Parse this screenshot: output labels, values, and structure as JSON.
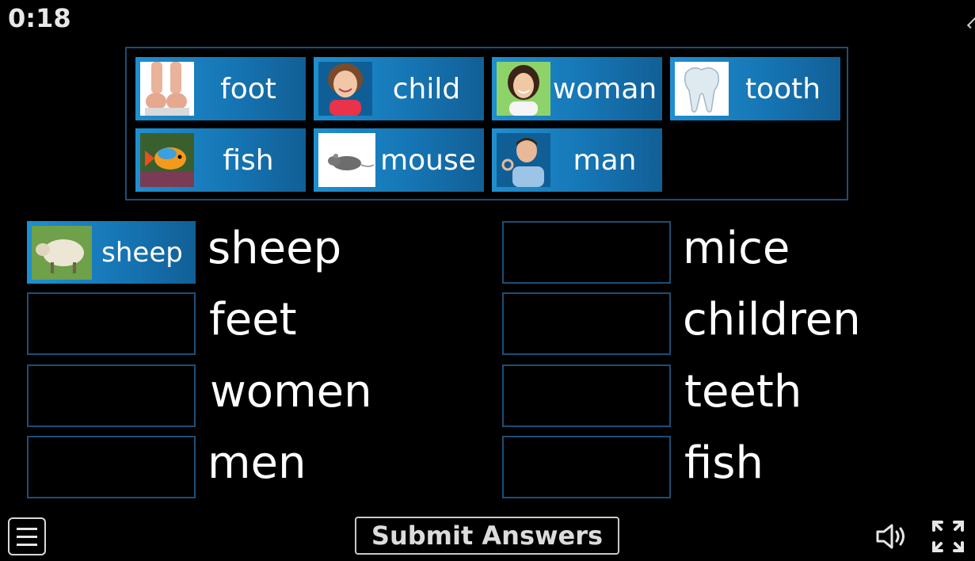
{
  "timer": "0:18",
  "bank": {
    "tiles": [
      {
        "label": "foot",
        "icon": "foot-photo"
      },
      {
        "label": "child",
        "icon": "child-photo"
      },
      {
        "label": "woman",
        "icon": "woman-photo"
      },
      {
        "label": "tooth",
        "icon": "tooth-photo"
      },
      {
        "label": "fish",
        "icon": "fish-photo"
      },
      {
        "label": "mouse",
        "icon": "mouse-photo"
      },
      {
        "label": "man",
        "icon": "man-photo"
      }
    ]
  },
  "targets": {
    "left": [
      {
        "word": "sheep",
        "placed": "sheep"
      },
      {
        "word": "feet",
        "placed": ""
      },
      {
        "word": "women",
        "placed": ""
      },
      {
        "word": "men",
        "placed": ""
      }
    ],
    "right": [
      {
        "word": "mice",
        "placed": ""
      },
      {
        "word": "children",
        "placed": ""
      },
      {
        "word": "teeth",
        "placed": ""
      },
      {
        "word": "fish",
        "placed": ""
      }
    ]
  },
  "footer": {
    "submit_label": "Submit Answers",
    "menu_icon": "menu-icon",
    "sound_icon": "speaker-icon",
    "fullscreen_icon": "fullscreen-icon"
  },
  "colors": {
    "tile": "#1676b5",
    "border": "#1d4e76",
    "background": "#000000"
  }
}
